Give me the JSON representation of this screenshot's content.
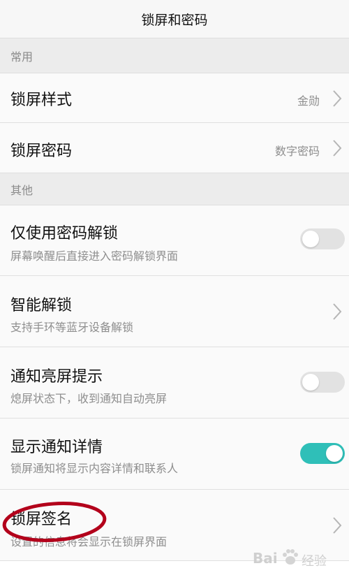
{
  "header": {
    "title": "锁屏和密码"
  },
  "sections": {
    "common": {
      "label": "常用"
    },
    "other": {
      "label": "其他"
    }
  },
  "rows": {
    "lock_style": {
      "label": "锁屏样式",
      "value": "金勋"
    },
    "lock_password": {
      "label": "锁屏密码",
      "value": "数字密码"
    },
    "password_only": {
      "label": "仅使用密码解锁",
      "sub": "屏幕唤醒后直接进入密码解锁界面",
      "toggle": "off"
    },
    "smart_unlock": {
      "label": "智能解锁",
      "sub": "支持手环等蓝牙设备解锁"
    },
    "notify_wake": {
      "label": "通知亮屏提示",
      "sub": "熄屏状态下，收到通知自动亮屏",
      "toggle": "off"
    },
    "show_details": {
      "label": "显示通知详情",
      "sub": "锁屏通知将显示内容详情和联系人",
      "toggle": "on"
    },
    "lock_signature": {
      "label": "锁屏签名",
      "sub": "设置的信息将会显示在锁屏界面"
    }
  },
  "watermark": {
    "brand": "Bai",
    "text": "经验"
  },
  "colors": {
    "accent": "#2fbfb8",
    "annotation": "#b3001b",
    "toggle_off": "#e2e2e2"
  }
}
